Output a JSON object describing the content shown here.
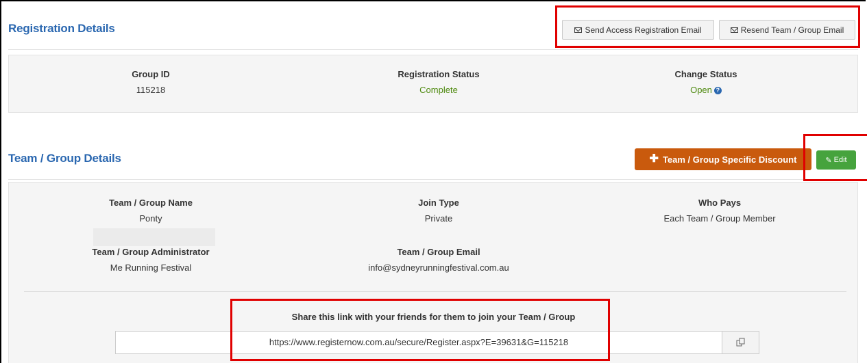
{
  "registration": {
    "title": "Registration Details",
    "send_access_label": "Send Access Registration Email",
    "resend_label": "Resend Team / Group Email",
    "group_id_label": "Group ID",
    "group_id_value": "115218",
    "status_label": "Registration Status",
    "status_value": "Complete",
    "change_label": "Change Status",
    "change_value": "Open"
  },
  "team": {
    "title": "Team / Group Details",
    "discount_label": "Team / Group Specific Discount",
    "edit_label": "Edit",
    "name_label": "Team / Group Name",
    "name_value": "Ponty",
    "join_label": "Join Type",
    "join_value": "Private",
    "pays_label": "Who Pays",
    "pays_value": "Each Team / Group Member",
    "admin_label": "Team / Group Administrator",
    "admin_value": "Me Running Festival",
    "email_label": "Team / Group Email",
    "email_value": "info@sydneyrunningfestival.com.au"
  },
  "share": {
    "label": "Share this link with your friends for them to join your Team / Group",
    "url": "https://www.registernow.com.au/secure/Register.aspx?E=39631&G=115218"
  },
  "colors": {
    "accent": "#2a67b0",
    "success": "#4f8a10",
    "discount": "#c95a0d",
    "edit": "#46a33d",
    "highlight": "#e00000"
  }
}
